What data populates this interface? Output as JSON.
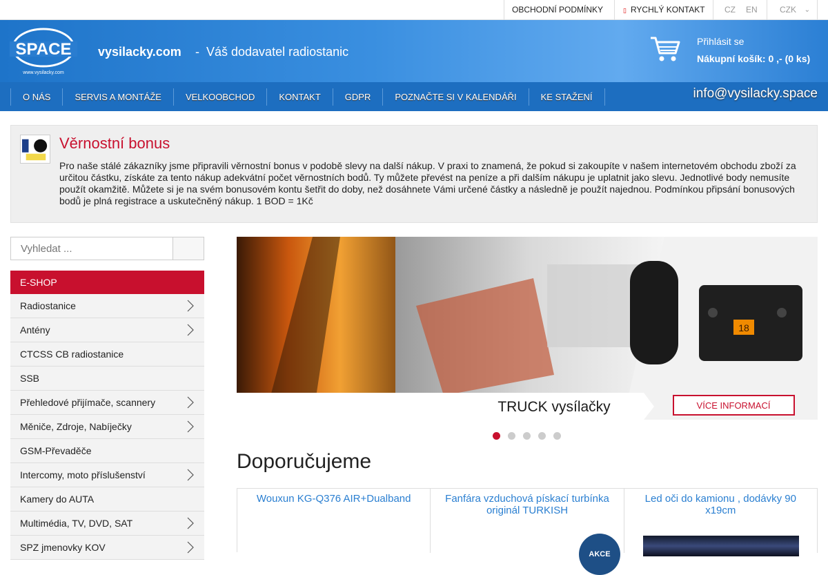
{
  "topbar": {
    "terms": "OBCHODNÍ PODMÍNKY",
    "quick_contact": "RYCHLÝ KONTAKT",
    "lang_cz": "CZ",
    "lang_en": "EN",
    "currency": "CZK"
  },
  "header": {
    "logo_text": "SPACE",
    "logo_url_text": "www.vysilacky.com",
    "site_name": "vysilacky.com",
    "separator": "-",
    "tagline": "Váš dodavatel radiostanic",
    "login": "Přihlásit se",
    "cart": "Nákupní košík: 0 ,- (0 ks)"
  },
  "nav": {
    "items": [
      "O NÁS",
      "SERVIS A MONTÁŽE",
      "VELKOOBCHOD",
      "KONTAKT",
      "GDPR",
      "POZNAČTE SI V KALENDÁŘI",
      "KE STAŽENÍ"
    ],
    "email": "info@vysilacky.space"
  },
  "bonus": {
    "title": "Věrnostní bonus",
    "text": "Pro naše stálé zákazníky jsme připravili věrnostní bonus v podobě slevy na další nákup. V praxi to znamená, že pokud si zakoupíte v našem internetovém obchodu zboží za určitou částku, získáte za tento nákup adekvátní počet věrnostních bodů. Ty můžete převést na peníze a při dalším nákupu je uplatnit jako slevu. Jednotlivé body nemusíte použít okamžitě. Můžete si je na svém bonusovém kontu šetřit do doby, než dosáhnete Vámi určené částky a následně je použít najednou. Podmínkou připsání bonusových bodů je plná registrace a uskutečněný nákup. 1 BOD = 1Kč"
  },
  "search": {
    "placeholder": "Vyhledat ..."
  },
  "categories": {
    "head": "E-SHOP",
    "items": [
      {
        "label": "Radiostanice",
        "arrow": true
      },
      {
        "label": "Antény",
        "arrow": true
      },
      {
        "label": "CTCSS CB radiostanice",
        "arrow": false
      },
      {
        "label": "SSB",
        "arrow": false
      },
      {
        "label": "Přehledové přijímače, scannery",
        "arrow": true
      },
      {
        "label": "Měniče, Zdroje, Nabíječky",
        "arrow": true
      },
      {
        "label": "GSM-Převaděče",
        "arrow": false
      },
      {
        "label": "Intercomy, moto příslušenství",
        "arrow": true
      },
      {
        "label": "Kamery do AUTA",
        "arrow": false
      },
      {
        "label": "Multimédia, TV, DVD, SAT",
        "arrow": true
      },
      {
        "label": "SPZ jmenovky KOV",
        "arrow": true
      }
    ]
  },
  "slider": {
    "caption": "TRUCK vysílačky",
    "button": "VÍCE INFORMACÍ",
    "radio_display": "18",
    "dot_count": 5,
    "active_dot": 0
  },
  "recommend": {
    "title": "Doporučujeme",
    "products": [
      {
        "name": "Wouxun KG-Q376 AIR+Dualband"
      },
      {
        "name": "Fanfára vzduchová pískací turbínka originál TURKISH"
      },
      {
        "name": "Led oči do kamionu , dodávky 90 x19cm"
      }
    ],
    "badge": "AKCE"
  },
  "colors": {
    "accent_red": "#c8102e",
    "header_blue": "#1e74c9",
    "nav_blue": "#1d6ec0",
    "link_blue": "#2a7fd1"
  }
}
